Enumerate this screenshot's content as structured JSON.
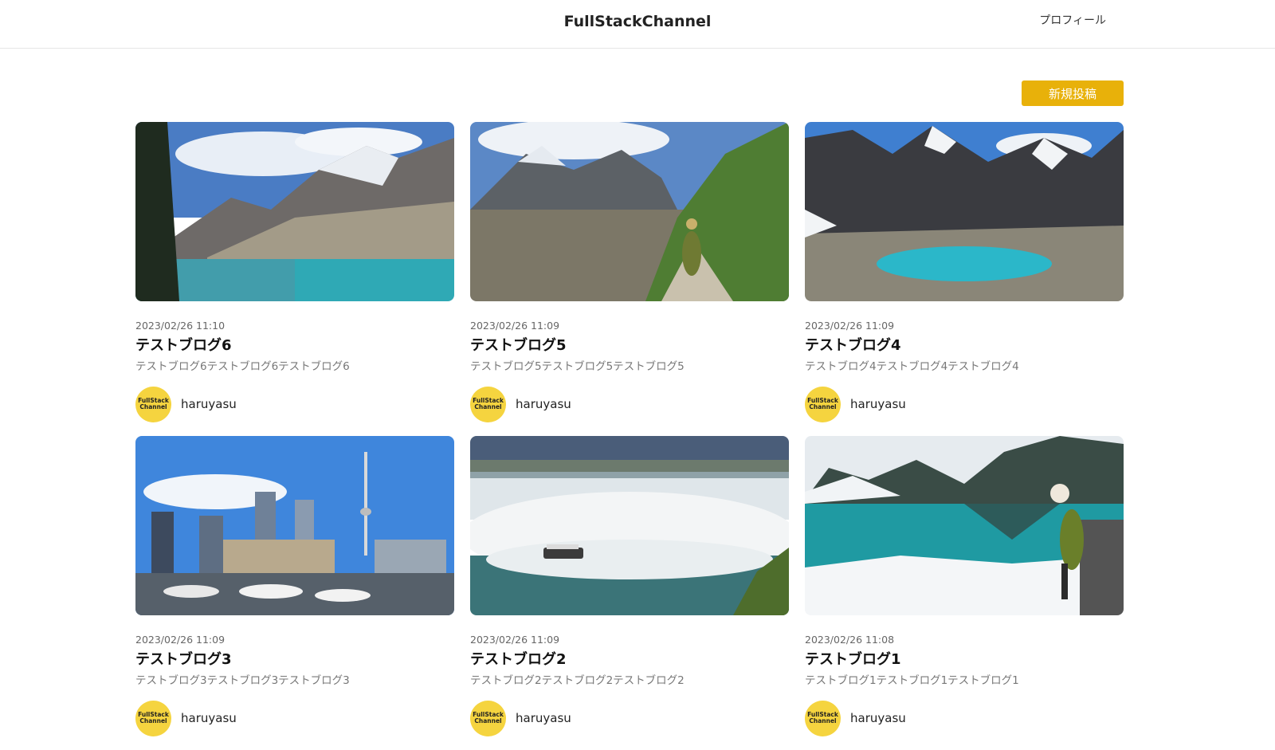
{
  "header": {
    "brand": "FullStackChannel",
    "profile_link": "プロフィール"
  },
  "actions": {
    "new_post_label": "新規投稿"
  },
  "accent_color": "#e8b10a",
  "posts": [
    {
      "date": "2023/02/26 11:10",
      "title": "テストブログ6",
      "excerpt": "テストブログ6テストブログ6テストブログ6",
      "author": "haruyasu",
      "avatar_line1": "FullStack",
      "avatar_line2": "Channel",
      "image": "mountain-lake"
    },
    {
      "date": "2023/02/26 11:09",
      "title": "テストブログ5",
      "excerpt": "テストブログ5テストブログ5テストブログ5",
      "author": "haruyasu",
      "avatar_line1": "FullStack",
      "avatar_line2": "Channel",
      "image": "mountain-hiker"
    },
    {
      "date": "2023/02/26 11:09",
      "title": "テストブログ4",
      "excerpt": "テストブログ4テストブログ4テストブログ4",
      "author": "haruyasu",
      "avatar_line1": "FullStack",
      "avatar_line2": "Channel",
      "image": "turquoise-tarn"
    },
    {
      "date": "2023/02/26 11:09",
      "title": "テストブログ3",
      "excerpt": "テストブログ3テストブログ3テストブログ3",
      "author": "haruyasu",
      "avatar_line1": "FullStack",
      "avatar_line2": "Channel",
      "image": "city-harbor"
    },
    {
      "date": "2023/02/26 11:09",
      "title": "テストブログ2",
      "excerpt": "テストブログ2テストブログ2テストブログ2",
      "author": "haruyasu",
      "avatar_line1": "FullStack",
      "avatar_line2": "Channel",
      "image": "waterfall"
    },
    {
      "date": "2023/02/26 11:08",
      "title": "テストブログ1",
      "excerpt": "テストブログ1テストブログ1テストブログ1",
      "author": "haruyasu",
      "avatar_line1": "FullStack",
      "avatar_line2": "Channel",
      "image": "winter-lake"
    }
  ]
}
